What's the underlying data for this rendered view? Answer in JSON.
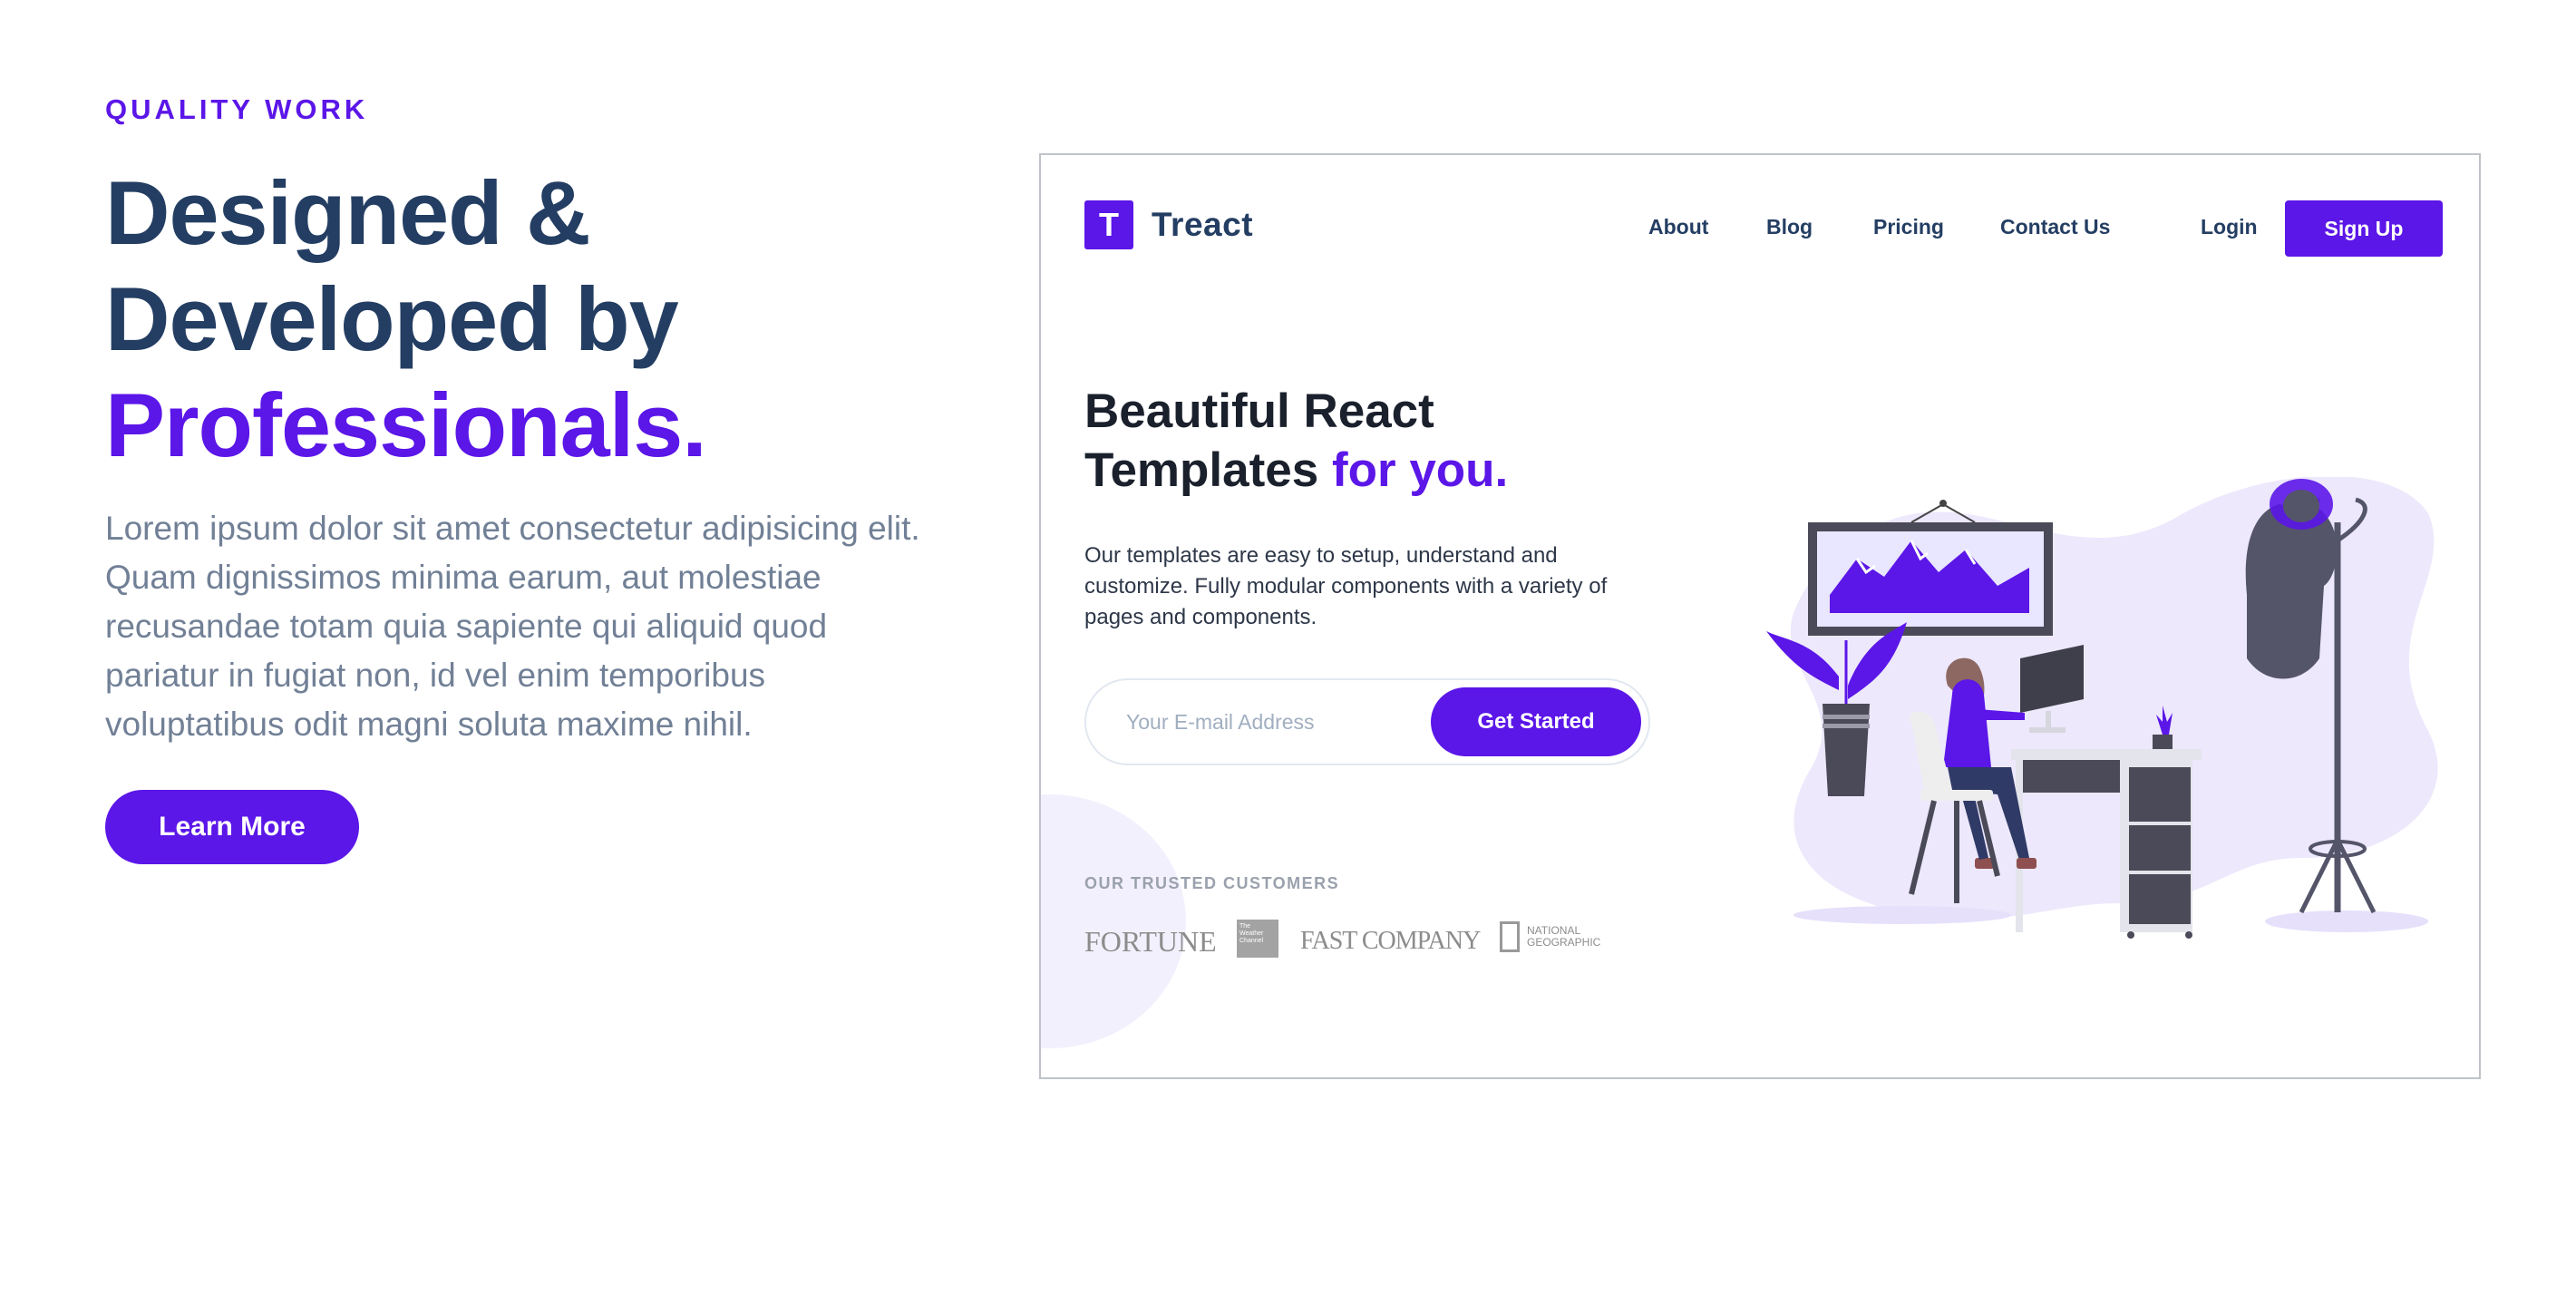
{
  "section": {
    "subheading": "QUALITY WORK",
    "heading": {
      "line1": "Designed &",
      "line2": "Developed by",
      "accent": "Professionals."
    },
    "description": [
      "Lorem ipsum dolor sit amet consectetur adipisicing elit.",
      "Quam dignissimos minima earum, aut molestiae",
      "recusandae totam quia sapiente qui aliquid quod",
      "pariatur in fugiat non, id vel enim temporibus",
      "voluptatibus odit magni soluta maxime nihil."
    ],
    "learn_more_label": "Learn More"
  },
  "preview": {
    "logo_letter": "T",
    "logo_text": "Treact",
    "nav": [
      "About",
      "Blog",
      "Pricing",
      "Contact Us"
    ],
    "login_label": "Login",
    "signup_label": "Sign Up",
    "hero": {
      "line1": "Beautiful React",
      "line2_plain": "Templates ",
      "line2_accent": "for you."
    },
    "hero_description": [
      "Our templates are easy to setup, understand and",
      "customize. Fully modular components with a variety of",
      "pages and components."
    ],
    "email_placeholder": "Your E-mail Address",
    "get_started_label": "Get Started",
    "trusted_label": "OUR TRUSTED CUSTOMERS",
    "customer_logos": {
      "fortune": "FORTUNE",
      "weather": [
        "The",
        "Weather",
        "Channel"
      ],
      "fast_company": "FAST COMPANY",
      "natgeo": [
        "NATIONAL",
        "GEOGRAPHIC"
      ]
    }
  },
  "colors": {
    "accent": "#5b16e8",
    "heading": "#243e63",
    "text_muted": "#718096"
  }
}
